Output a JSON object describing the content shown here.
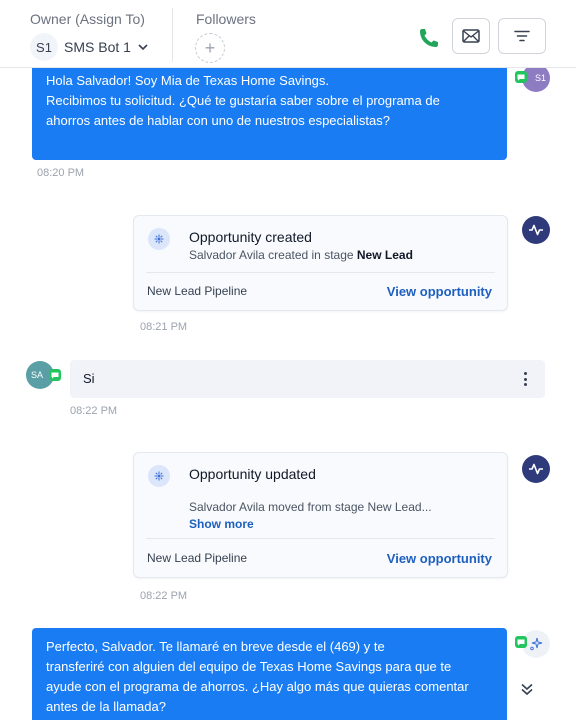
{
  "header": {
    "owner_label": "Owner (Assign To)",
    "owner_initials": "S1",
    "owner_name": "SMS Bot 1",
    "followers_label": "Followers",
    "add_follower": "+"
  },
  "colors": {
    "outgoing_bubble": "#1a7cf2",
    "activity_icon": "#2e3a79",
    "link": "#1e5fbf",
    "call_icon": "#22a55a",
    "sms_badge": "#22c55e"
  },
  "messages": {
    "first": {
      "lines": [
        "Hola Salvador! Soy Mia de Texas Home Savings.",
        "Recibimos tu solicitud. ¿Qué te gustaría saber sobre el programa de",
        "ahorros antes de hablar con uno de nuestros especialistas?"
      ],
      "time": "08:20 PM",
      "avatar": "S1"
    },
    "opportunity_created": {
      "title": "Opportunity created",
      "sub_prefix": "Salvador Avila created in stage ",
      "sub_stage": "New Lead",
      "pipeline": "New Lead Pipeline",
      "link": "View opportunity",
      "time": "08:21 PM"
    },
    "incoming": {
      "avatar": "SA",
      "text": "Si",
      "time": "08:22 PM"
    },
    "opportunity_updated": {
      "title": "Opportunity updated",
      "sub": "Salvador Avila moved from stage New Lead...",
      "show_more": "Show more",
      "pipeline": "New Lead Pipeline",
      "link": "View opportunity",
      "time": "08:22 PM"
    },
    "last": {
      "lines": [
        "Perfecto, Salvador. Te llamaré en breve desde el (469)                   y te",
        "transferiré con alguien del equipo de Texas Home Savings para que te",
        "ayude con el programa de ahorros. ¿Hay algo más que quieras comentar",
        "antes de la llamada?"
      ]
    }
  },
  "icons": {
    "call": "phone-icon",
    "email": "envelope-icon",
    "filter": "filter-icon",
    "activity": "activity-pulse-icon",
    "opportunity": "opportunity-icon",
    "scroll": "double-chevron-down-icon"
  }
}
